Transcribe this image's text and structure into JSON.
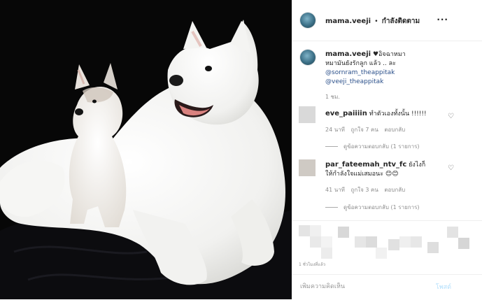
{
  "post": {
    "image_alt": "Large white Swiss Shepherd dog and white husky puppy on black background",
    "header": {
      "username": "mama.veeji",
      "separator": "•",
      "follow_status": "กำลังติดตาม",
      "more_icon": "more-dots-icon"
    },
    "caption": {
      "username": "mama.veeji",
      "text_line1": "♥อิจฉาหมา",
      "text_line2": "หมามันยังรักลูก แล้ว .. ละ",
      "mention1": "@sornram_theappitak",
      "mention2": "@veeji_theappitak",
      "time": "1 ชม."
    },
    "comments": [
      {
        "username": "eve_paiiiin",
        "text": "ทำตัวเองทั้งนั้น !!!!!!",
        "time": "24 นาที",
        "likes": "ถูกใจ 7 คน",
        "reply": "ตอบกลับ",
        "view_replies": "ดูข้อความตอบกลับ (1 รายการ)"
      },
      {
        "username": "par_fateemah_ntv_fc",
        "text": "ยังไงก็ให้กำลังใจแม่เสมอนะ 😊😊",
        "time": "41 นาที",
        "likes": "ถูกใจ 3 คน",
        "reply": "ตอบกลับ",
        "view_replies": "ดูข้อความตอบกลับ (1 รายการ)"
      }
    ],
    "posted_ago": "1 ชั่วโมงที่แล้ว",
    "add_comment_placeholder": "เพิ่มความคิดเห็น",
    "post_button": "โพสต์"
  },
  "colors": {
    "link": "#2a4f8a",
    "meta": "#8e8e8e",
    "post_button_disabled": "#b2dffc"
  }
}
